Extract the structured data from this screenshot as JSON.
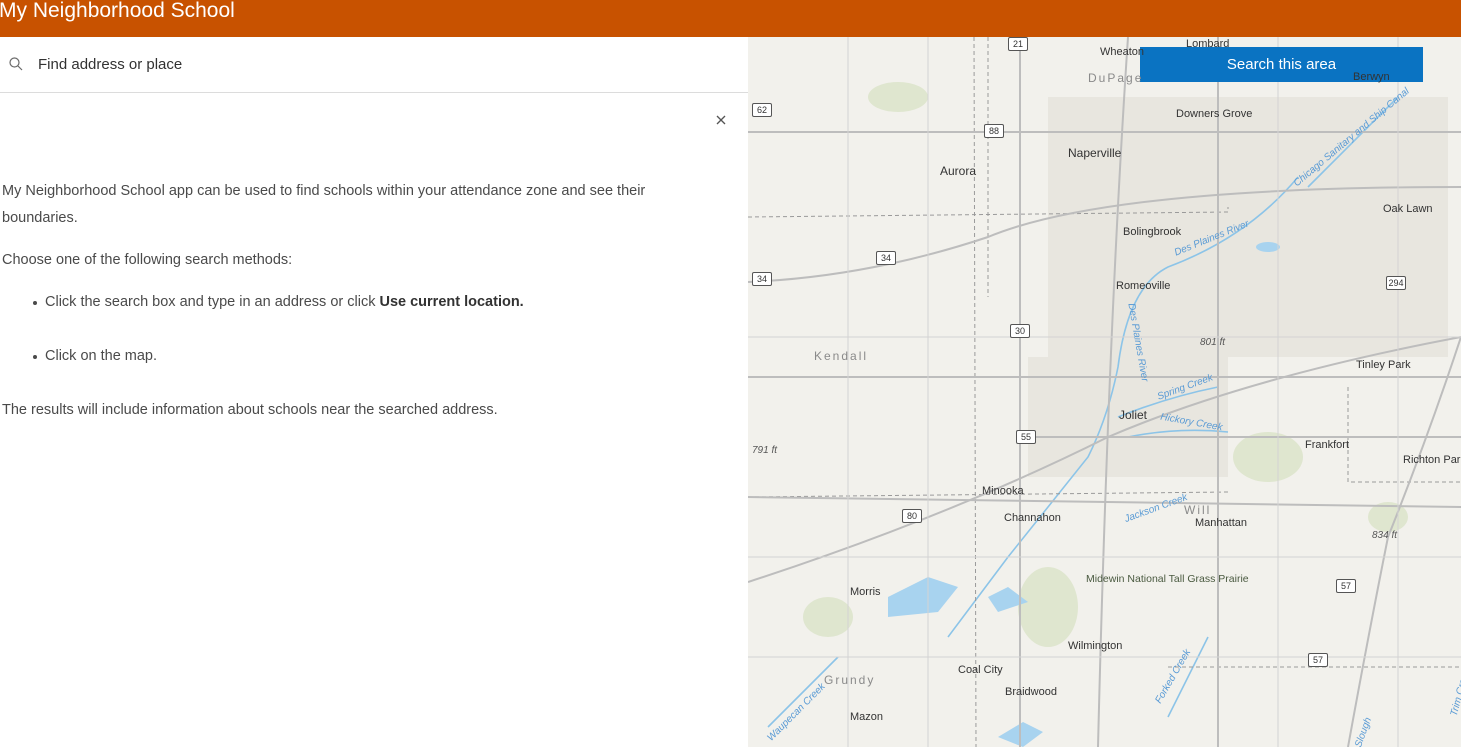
{
  "app": {
    "title": "My Neighborhood School"
  },
  "search": {
    "placeholder": "Find address or place"
  },
  "intro": {
    "paragraph1": "My Neighborhood School app can be used to find schools within your attendance zone and see their boundaries.",
    "paragraph2": "Choose one of the following search methods:",
    "bullet1_text": "Click the search box and type in an address or click ",
    "bullet1_bold": "Use current location.",
    "bullet2_text": "Click on the map.",
    "paragraph3": "The results will include information about schools near the searched address."
  },
  "map": {
    "search_area_label": "Search this area",
    "places": {
      "wheaton": "Wheaton",
      "lombard": "Lombard",
      "berwyn": "Berwyn",
      "dupage": "DuPage",
      "downers_grove": "Downers Grove",
      "naperville": "Naperville",
      "aurora": "Aurora",
      "oak_lawn": "Oak Lawn",
      "bolingbrook": "Bolingbrook",
      "romeoville": "Romeoville",
      "kendall": "Kendall",
      "tinley_park": "Tinley Park",
      "joliet": "Joliet",
      "frankfort": "Frankfort",
      "richton_park": "Richton Park",
      "minooka": "Minooka",
      "channahon": "Channahon",
      "will": "Will",
      "manhattan": "Manhattan",
      "morris": "Morris",
      "midewin": "Midewin National Tall Grass Prairie",
      "wilmington": "Wilmington",
      "coal_city": "Coal City",
      "grundy": "Grundy",
      "braidwood": "Braidwood",
      "mazon": "Mazon"
    },
    "water": {
      "chicago_canal": "Chicago Sanitary and Ship Canal",
      "des_plaines_river": "Des Plaines River",
      "des_plaines_river_2": "Des Plaines River",
      "spring_creek": "Spring Creek",
      "hickory_creek": "Hickory Creek",
      "jackson_creek": "Jackson Creek",
      "forked_creek": "Forked Creek",
      "waupecan_creek": "Waupecan Creek",
      "trim_creek": "Trim Creek",
      "slough": "Slough"
    },
    "elevations": {
      "e801": "801 ft",
      "e791": "791 ft",
      "e834": "834 ft"
    },
    "shields": {
      "s21": "21",
      "s62": "62",
      "s88": "88",
      "s34a": "34",
      "s34b": "34",
      "s30": "30",
      "s294": "294",
      "s55": "55",
      "s80": "80",
      "s57a": "57",
      "s57b": "57"
    }
  }
}
